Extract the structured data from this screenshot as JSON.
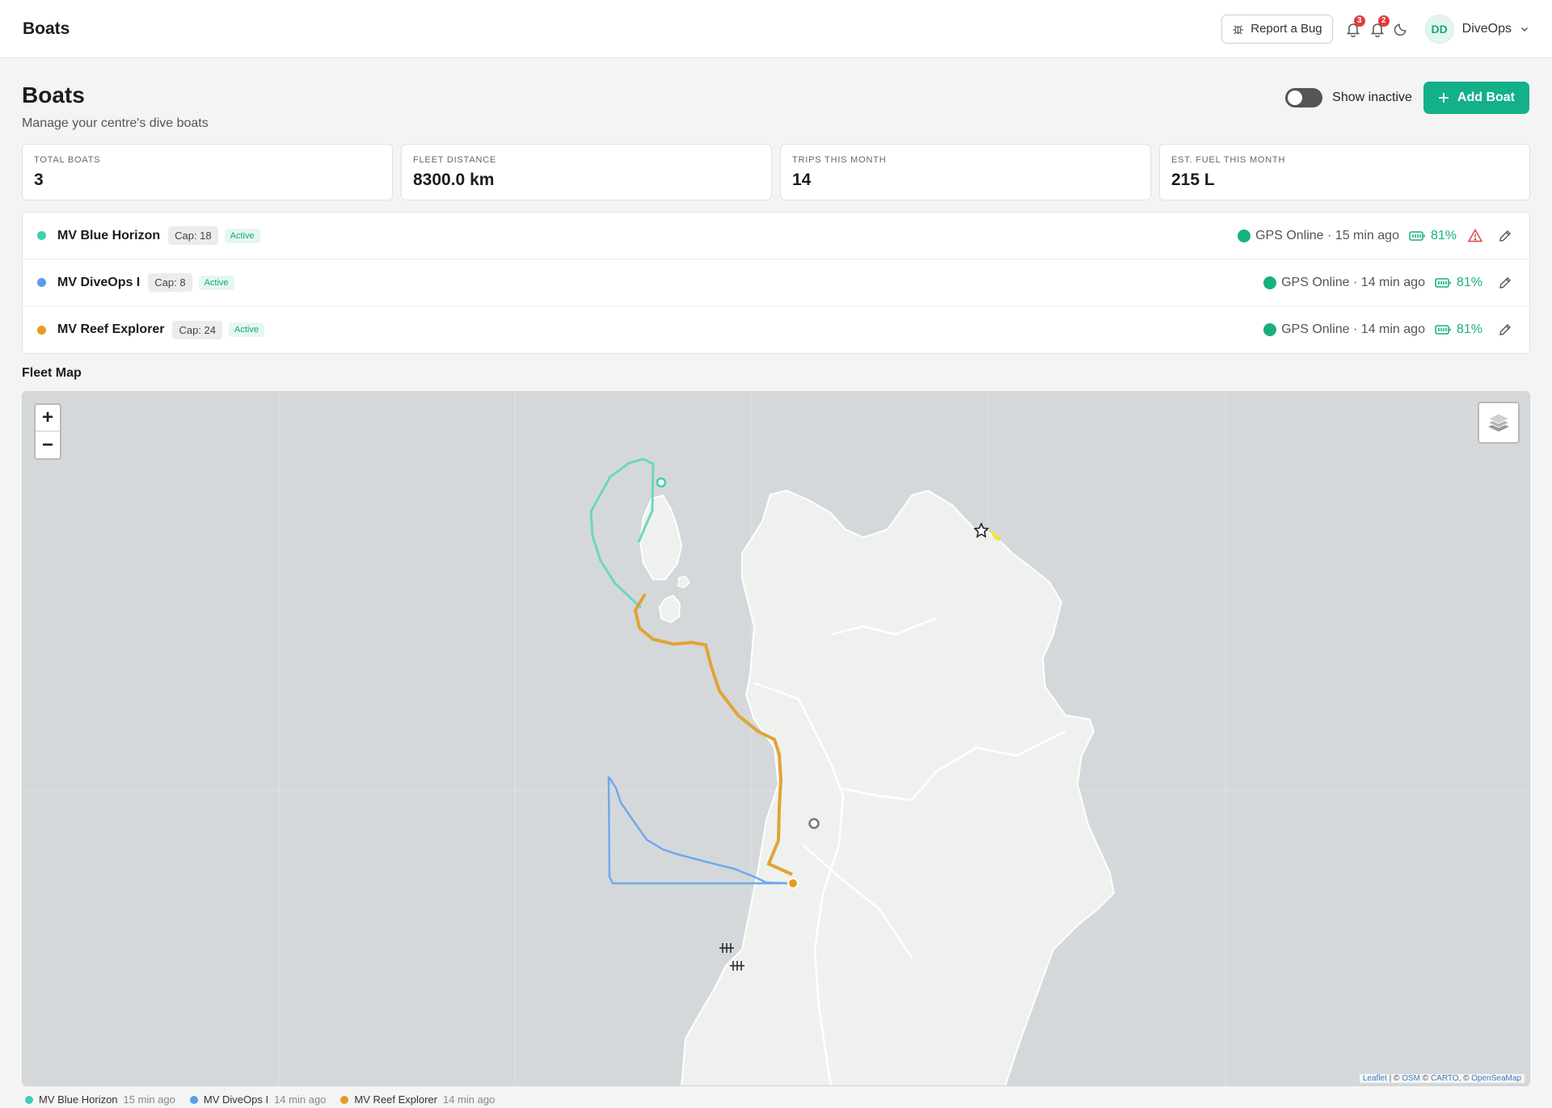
{
  "topbar": {
    "title": "Boats",
    "report_bug_label": "Report a Bug",
    "notifications_count_1": "3",
    "notifications_count_2": "2",
    "avatar_initials": "DD",
    "user_name": "DiveOps"
  },
  "page": {
    "title": "Boats",
    "subtitle": "Manage your centre's dive boats",
    "show_inactive_label": "Show inactive",
    "show_inactive": false,
    "add_boat_label": "Add Boat"
  },
  "stats": [
    {
      "label": "Total Boats",
      "value": "3"
    },
    {
      "label": "Fleet Distance",
      "value": "8300.0 km"
    },
    {
      "label": "Trips This Month",
      "value": "14"
    },
    {
      "label": "Est. Fuel This Month",
      "value": "215 L"
    }
  ],
  "boats": [
    {
      "name": "MV Blue Horizon",
      "capacity": "Cap: 18",
      "status": "Active",
      "gps": "GPS Online · 15 min ago",
      "battery": "81%",
      "color": "#3fcfb1",
      "warning": true
    },
    {
      "name": "MV DiveOps I",
      "capacity": "Cap: 8",
      "status": "Active",
      "gps": "GPS Online · 14 min ago",
      "battery": "81%",
      "color": "#5b9ee6",
      "warning": false
    },
    {
      "name": "MV Reef Explorer",
      "capacity": "Cap: 24",
      "status": "Active",
      "gps": "GPS Online · 14 min ago",
      "battery": "81%",
      "color": "#e89c1c",
      "warning": false
    }
  ],
  "map": {
    "title": "Fleet Map",
    "zoom_in": "+",
    "zoom_out": "−",
    "attribution": {
      "leaflet": "Leaflet",
      "separator": " | © ",
      "osm": "OSM",
      "carto": "CARTO",
      "osm_full": "OpenSeaMap"
    }
  },
  "legend": [
    {
      "name": "MV Blue Horizon",
      "time": "15 min ago",
      "color": "#3fcfb1"
    },
    {
      "name": "MV DiveOps I",
      "time": "14 min ago",
      "color": "#5b9ee6"
    },
    {
      "name": "MV Reef Explorer",
      "time": "14 min ago",
      "color": "#e89c1c"
    }
  ],
  "colors": {
    "accent": "#13b08a",
    "gps_online": "#18b07f",
    "warning": "#e0463f",
    "water": "#d5d8da",
    "land": "#eff1ef"
  },
  "icons": {
    "bug": "bug-icon",
    "bell": "bell-icon",
    "moon": "moon-icon",
    "chevron": "chevron-down-icon",
    "plus": "plus-icon",
    "battery": "battery-icon",
    "warning": "warning-icon",
    "edit": "pencil-icon",
    "layers": "layers-icon",
    "star": "star-icon",
    "wreck": "wreck-icon"
  }
}
